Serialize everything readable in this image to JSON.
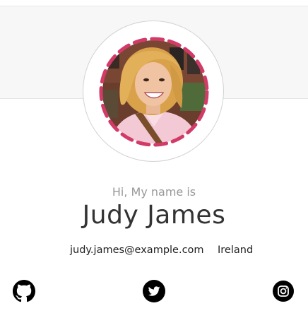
{
  "profile": {
    "greeting": "Hi, My name is",
    "name": "Judy James",
    "email": "judy.james@example.com",
    "country": "Ireland"
  },
  "social": {
    "github_icon": "github-icon",
    "twitter_icon": "twitter-icon",
    "instagram_icon": "instagram-icon"
  },
  "colors": {
    "accent_dash": "#d23a68",
    "header_band": "#f7f7f7",
    "icon": "#000000"
  }
}
